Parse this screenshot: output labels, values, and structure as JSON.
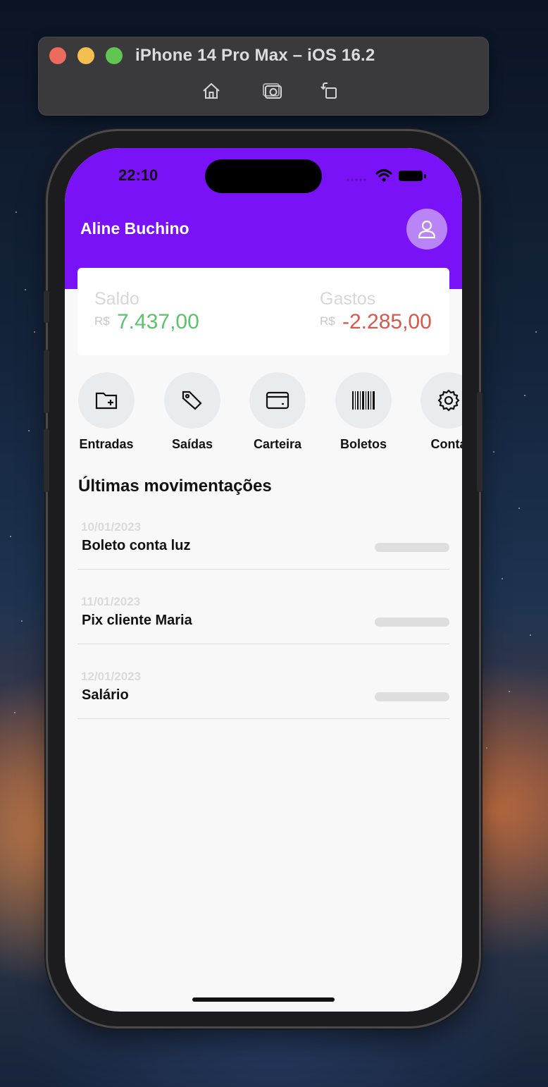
{
  "simulator": {
    "title": "iPhone 14 Pro Max – iOS 16.2",
    "buttons": [
      "home-icon",
      "screenshot-icon",
      "rotate-icon"
    ]
  },
  "status_bar": {
    "time": "22:10"
  },
  "header": {
    "user_name": "Aline Buchino"
  },
  "balance": {
    "saldo_label": "Saldo",
    "saldo_currency": "R$",
    "saldo_value": "7.437,00",
    "gastos_label": "Gastos",
    "gastos_currency": "R$",
    "gastos_value": "-2.285,00"
  },
  "actions": [
    {
      "label": "Entradas",
      "icon": "folder-plus-icon"
    },
    {
      "label": "Saídas",
      "icon": "tag-icon"
    },
    {
      "label": "Carteira",
      "icon": "credit-card-icon"
    },
    {
      "label": "Boletos",
      "icon": "barcode-icon"
    },
    {
      "label": "Conta",
      "icon": "gear-icon"
    }
  ],
  "movements_title": "Últimas movimentações",
  "movements": [
    {
      "date": "10/01/2023",
      "title": "Boleto conta luz"
    },
    {
      "date": "11/01/2023",
      "title": "Pix cliente Maria"
    },
    {
      "date": "12/01/2023",
      "title": "Salário"
    }
  ],
  "colors": {
    "brand": "#7a12f7",
    "positive": "#5cc26b",
    "negative": "#d9574b"
  }
}
